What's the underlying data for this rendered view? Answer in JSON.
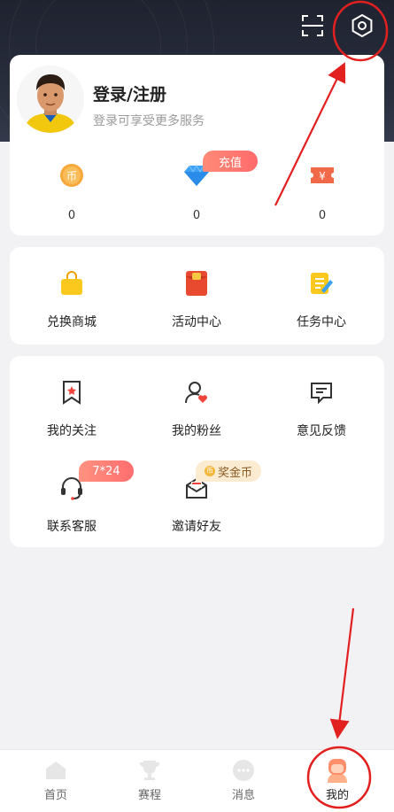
{
  "header": {
    "scan_icon": "scan-icon",
    "settings_icon": "settings-icon"
  },
  "profile": {
    "title": "登录/注册",
    "subtitle": "登录可享受更多服务",
    "avatar_icon": "user-avatar"
  },
  "stats": [
    {
      "icon": "coin-icon",
      "value": "0"
    },
    {
      "icon": "diamond-icon",
      "value": "0",
      "badge": "充值"
    },
    {
      "icon": "ticket-icon",
      "value": "0"
    }
  ],
  "shop": [
    {
      "icon": "shopping-bag-icon",
      "label": "兑换商城"
    },
    {
      "icon": "red-envelope-icon",
      "label": "活动中心"
    },
    {
      "icon": "task-icon",
      "label": "任务中心"
    }
  ],
  "functions": [
    {
      "icon": "bookmark-star-icon",
      "label": "我的关注"
    },
    {
      "icon": "fans-icon",
      "label": "我的粉丝"
    },
    {
      "icon": "feedback-icon",
      "label": "意见反馈"
    },
    {
      "icon": "headset-icon",
      "label": "联系客服",
      "badge": "7*24"
    },
    {
      "icon": "mail-icon",
      "label": "邀请好友",
      "badge": "奖金币",
      "badge_coin": "币"
    }
  ],
  "tabbar": [
    {
      "icon": "home-icon",
      "label": "首页",
      "active": false
    },
    {
      "icon": "trophy-icon",
      "label": "赛程",
      "active": false
    },
    {
      "icon": "chat-icon",
      "label": "消息",
      "active": false
    },
    {
      "icon": "profile-icon",
      "label": "我的",
      "active": true
    }
  ],
  "colors": {
    "accent": "#ff6b6b",
    "header_bg": "#2a2f3e",
    "annotation_red": "#e32020"
  }
}
